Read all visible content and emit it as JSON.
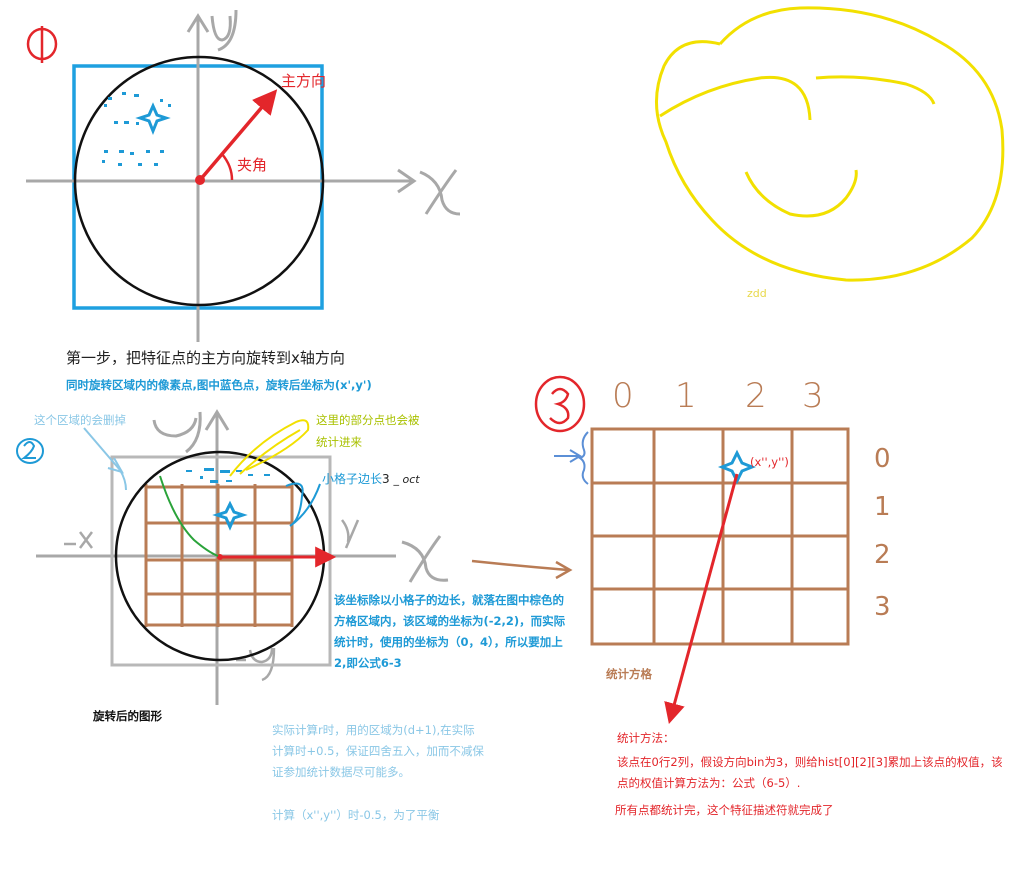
{
  "panel1": {
    "step_marker": "①",
    "axis_x": "X",
    "axis_y": "y",
    "main_direction_label": "主方向",
    "angle_label": "夹角",
    "step1_text": "第一步，把特征点的主方向旋转到x轴方向",
    "step1_note": "同时旋转区域内的像素点,图中蓝色点，旋转后坐标为(x',y')"
  },
  "smiley": {
    "signature": "zdd"
  },
  "panel2": {
    "step_marker": "2",
    "axis_x": "X",
    "axis_y": "y",
    "axis_neg_x": "-x",
    "axis_neg_y": "-y",
    "axis_x_small": "x",
    "deleted_region_note": "这个区域的会删掉",
    "partial_points_note_line1": "这里的部分点也会被",
    "partial_points_note_line2": "统计进来",
    "cell_side_label": "小格子边长",
    "cell_side_formula_3": "3",
    "cell_side_formula_sigma": "_ oct",
    "coordinate_explanation": "该坐标除以小格子的边长，就落在图中棕色的方格区域内，该区域的坐标为(-2,2)，而实际统计时，使用的坐标为（0，4），所以要加上2,即公式6-3",
    "rotated_caption": "旋转后的图形",
    "radius_note": "实际计算r时，用的区域为(d+1),在实际计算时+0.5，保证四舍五入，加而不减保证参加统计数据尽可能多。",
    "xy_note": "计算（x'',y''）时-0.5，为了平衡"
  },
  "panel3": {
    "step_marker": "3",
    "col_headers": [
      "0",
      "1",
      "2",
      "3"
    ],
    "row_headers": [
      "0",
      "1",
      "2",
      "3"
    ],
    "point_label": "(x'',y'')",
    "grid_caption": "统计方格",
    "method_title": "统计方法：",
    "method_body": "该点在0行2列，假设方向bin为3，则给hist[0][2][3]累加上该点的权值，该点的权值计算方法为：公式（6-5）.",
    "conclusion": "所有点都统计完，这个特征描述符就完成了"
  },
  "colors": {
    "red": "#e3262b",
    "blue_frame": "#1ea0e0",
    "text_blue": "#1e9ad6",
    "brown": "#b97c55",
    "gray": "#a8a8a8",
    "yellow": "#f2e000",
    "green": "#2aa33a",
    "light_blue": "#8ac7e6"
  }
}
